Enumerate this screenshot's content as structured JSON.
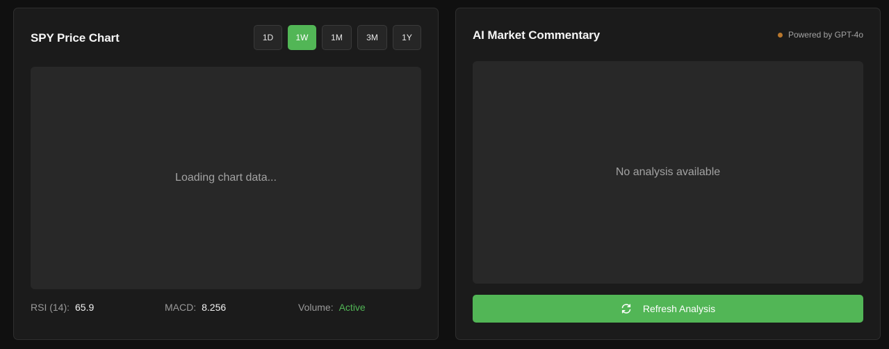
{
  "chart_panel": {
    "title": "SPY Price Chart",
    "ranges": [
      "1D",
      "1W",
      "1M",
      "3M",
      "1Y"
    ],
    "active_range": "1W",
    "loading_text": "Loading chart data...",
    "stats": {
      "rsi_label": "RSI (14):",
      "rsi_value": "65.9",
      "macd_label": "MACD:",
      "macd_value": "8.256",
      "volume_label": "Volume:",
      "volume_value": "Active"
    }
  },
  "commentary_panel": {
    "title": "AI Market Commentary",
    "powered_by": "Powered by GPT-4o",
    "empty_text": "No analysis available",
    "refresh_label": "Refresh Analysis"
  },
  "colors": {
    "accent_green": "#52b656",
    "status_dot": "#b8772d",
    "panel_bg": "#1b1b1b",
    "content_bg": "#282828"
  },
  "icons": {
    "refresh": "refresh-icon",
    "status": "status-dot-icon"
  }
}
